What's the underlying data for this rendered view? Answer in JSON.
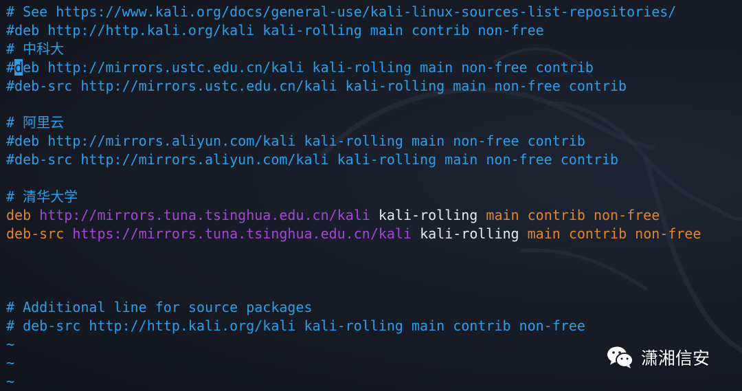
{
  "editor": {
    "lines": [
      {
        "type": "comment",
        "text": "# See https://www.kali.org/docs/general-use/kali-linux-sources-list-repositories/"
      },
      {
        "type": "comment",
        "text": "#deb http://http.kali.org/kali kali-rolling main contrib non-free"
      },
      {
        "type": "comment",
        "text": "# 中科大"
      },
      {
        "type": "cursor_line",
        "prefix": "#",
        "cursor_char": "d",
        "rest": "eb http://mirrors.ustc.edu.cn/kali kali-rolling main non-free contrib"
      },
      {
        "type": "comment",
        "text": "#deb-src http://mirrors.ustc.edu.cn/kali kali-rolling main non-free contrib"
      },
      {
        "type": "blank",
        "text": ""
      },
      {
        "type": "comment",
        "text": "# 阿里云"
      },
      {
        "type": "comment",
        "text": "#deb http://mirrors.aliyun.com/kali kali-rolling main non-free contrib"
      },
      {
        "type": "comment",
        "text": "#deb-src http://mirrors.aliyun.com/kali kali-rolling main non-free contrib"
      },
      {
        "type": "blank",
        "text": ""
      },
      {
        "type": "comment",
        "text": "# 清华大学"
      },
      {
        "type": "source",
        "keyword": "deb",
        "url": "http://mirrors.tuna.tsinghua.edu.cn/kali",
        "suite": "kali-rolling",
        "components": "main contrib non-free"
      },
      {
        "type": "source",
        "keyword": "deb-src",
        "url": "https://mirrors.tuna.tsinghua.edu.cn/kali",
        "suite": "kali-rolling",
        "components": "main contrib non-free"
      },
      {
        "type": "blank",
        "text": ""
      },
      {
        "type": "blank",
        "text": ""
      },
      {
        "type": "blank",
        "text": ""
      },
      {
        "type": "comment",
        "text": "# Additional line for source packages"
      },
      {
        "type": "comment",
        "text": "# deb-src http://http.kali.org/kali kali-rolling main contrib non-free"
      },
      {
        "type": "tilde",
        "text": "~"
      },
      {
        "type": "tilde",
        "text": "~"
      },
      {
        "type": "tilde",
        "text": "~"
      }
    ]
  },
  "watermark": {
    "icon": "wechat-icon",
    "label": "潇湘信安"
  },
  "colors": {
    "background": "#171b25",
    "comment": "#2d9ee8",
    "keyword": "#e3862b",
    "url": "#a347d6",
    "plain": "#e8eaf0",
    "cursor": "#2d9ee8"
  }
}
